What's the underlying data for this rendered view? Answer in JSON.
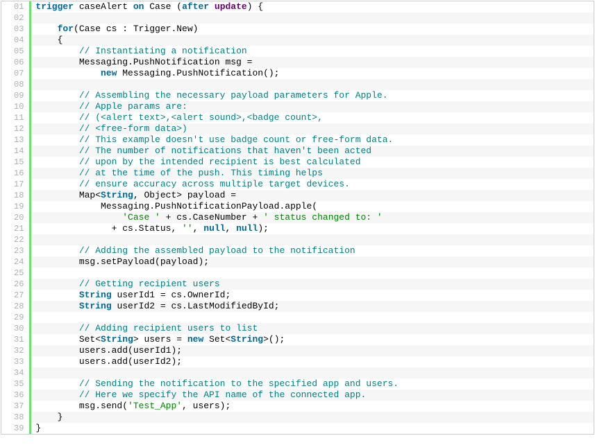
{
  "code": {
    "lines": [
      [
        {
          "t": "kw",
          "v": "trigger"
        },
        {
          "t": "plain",
          "v": " caseAlert "
        },
        {
          "t": "kw",
          "v": "on"
        },
        {
          "t": "plain",
          "v": " Case ("
        },
        {
          "t": "kw",
          "v": "after"
        },
        {
          "t": "plain",
          "v": " "
        },
        {
          "t": "ctrl",
          "v": "update"
        },
        {
          "t": "plain",
          "v": ") {"
        }
      ],
      [],
      [
        {
          "t": "plain",
          "v": "    "
        },
        {
          "t": "kw",
          "v": "for"
        },
        {
          "t": "plain",
          "v": "(Case cs : Trigger.New)"
        }
      ],
      [
        {
          "t": "plain",
          "v": "    {"
        }
      ],
      [
        {
          "t": "plain",
          "v": "        "
        },
        {
          "t": "cmt",
          "v": "// Instantiating a notification"
        }
      ],
      [
        {
          "t": "plain",
          "v": "        Messaging.PushNotification msg ="
        }
      ],
      [
        {
          "t": "plain",
          "v": "            "
        },
        {
          "t": "kw",
          "v": "new"
        },
        {
          "t": "plain",
          "v": " Messaging.PushNotification();"
        }
      ],
      [],
      [
        {
          "t": "plain",
          "v": "        "
        },
        {
          "t": "cmt",
          "v": "// Assembling the necessary payload parameters for Apple."
        }
      ],
      [
        {
          "t": "plain",
          "v": "        "
        },
        {
          "t": "cmt",
          "v": "// Apple params are:"
        }
      ],
      [
        {
          "t": "plain",
          "v": "        "
        },
        {
          "t": "cmt",
          "v": "// (<alert text>,<alert sound>,<badge count>,"
        }
      ],
      [
        {
          "t": "plain",
          "v": "        "
        },
        {
          "t": "cmt",
          "v": "// <free-form data>)"
        }
      ],
      [
        {
          "t": "plain",
          "v": "        "
        },
        {
          "t": "cmt",
          "v": "// This example doesn't use badge count or free-form data."
        }
      ],
      [
        {
          "t": "plain",
          "v": "        "
        },
        {
          "t": "cmt",
          "v": "// The number of notifications that haven't been acted"
        }
      ],
      [
        {
          "t": "plain",
          "v": "        "
        },
        {
          "t": "cmt",
          "v": "// upon by the intended recipient is best calculated"
        }
      ],
      [
        {
          "t": "plain",
          "v": "        "
        },
        {
          "t": "cmt",
          "v": "// at the time of the push. This timing helps"
        }
      ],
      [
        {
          "t": "plain",
          "v": "        "
        },
        {
          "t": "cmt",
          "v": "// ensure accuracy across multiple target devices."
        }
      ],
      [
        {
          "t": "plain",
          "v": "        Map<"
        },
        {
          "t": "type",
          "v": "String"
        },
        {
          "t": "plain",
          "v": ", Object> payload ="
        }
      ],
      [
        {
          "t": "plain",
          "v": "            Messaging.PushNotificationPayload.apple("
        }
      ],
      [
        {
          "t": "plain",
          "v": "                "
        },
        {
          "t": "str",
          "v": "'Case '"
        },
        {
          "t": "plain",
          "v": " + cs.CaseNumber + "
        },
        {
          "t": "str",
          "v": "' status changed to: '"
        }
      ],
      [
        {
          "t": "plain",
          "v": "              + cs.Status, "
        },
        {
          "t": "str",
          "v": "''"
        },
        {
          "t": "plain",
          "v": ", "
        },
        {
          "t": "nul",
          "v": "null"
        },
        {
          "t": "plain",
          "v": ", "
        },
        {
          "t": "nul",
          "v": "null"
        },
        {
          "t": "plain",
          "v": ");"
        }
      ],
      [],
      [
        {
          "t": "plain",
          "v": "        "
        },
        {
          "t": "cmt",
          "v": "// Adding the assembled payload to the notification"
        }
      ],
      [
        {
          "t": "plain",
          "v": "        msg.setPayload(payload);"
        }
      ],
      [],
      [
        {
          "t": "plain",
          "v": "        "
        },
        {
          "t": "cmt",
          "v": "// Getting recipient users"
        }
      ],
      [
        {
          "t": "plain",
          "v": "        "
        },
        {
          "t": "type",
          "v": "String"
        },
        {
          "t": "plain",
          "v": " userId1 = cs.OwnerId;"
        }
      ],
      [
        {
          "t": "plain",
          "v": "        "
        },
        {
          "t": "type",
          "v": "String"
        },
        {
          "t": "plain",
          "v": " userId2 = cs.LastModifiedById;"
        }
      ],
      [],
      [
        {
          "t": "plain",
          "v": "        "
        },
        {
          "t": "cmt",
          "v": "// Adding recipient users to list"
        }
      ],
      [
        {
          "t": "plain",
          "v": "        Set<"
        },
        {
          "t": "type",
          "v": "String"
        },
        {
          "t": "plain",
          "v": "> users = "
        },
        {
          "t": "kw",
          "v": "new"
        },
        {
          "t": "plain",
          "v": " Set<"
        },
        {
          "t": "type",
          "v": "String"
        },
        {
          "t": "plain",
          "v": ">();"
        }
      ],
      [
        {
          "t": "plain",
          "v": "        users.add(userId1);"
        }
      ],
      [
        {
          "t": "plain",
          "v": "        users.add(userId2);"
        }
      ],
      [],
      [
        {
          "t": "plain",
          "v": "        "
        },
        {
          "t": "cmt",
          "v": "// Sending the notification to the specified app and users."
        }
      ],
      [
        {
          "t": "plain",
          "v": "        "
        },
        {
          "t": "cmt",
          "v": "// Here we specify the API name of the connected app."
        }
      ],
      [
        {
          "t": "plain",
          "v": "        msg.send("
        },
        {
          "t": "str",
          "v": "'Test_App'"
        },
        {
          "t": "plain",
          "v": ", users);"
        }
      ],
      [
        {
          "t": "plain",
          "v": "    }"
        }
      ],
      [
        {
          "t": "plain",
          "v": "}"
        }
      ]
    ]
  }
}
